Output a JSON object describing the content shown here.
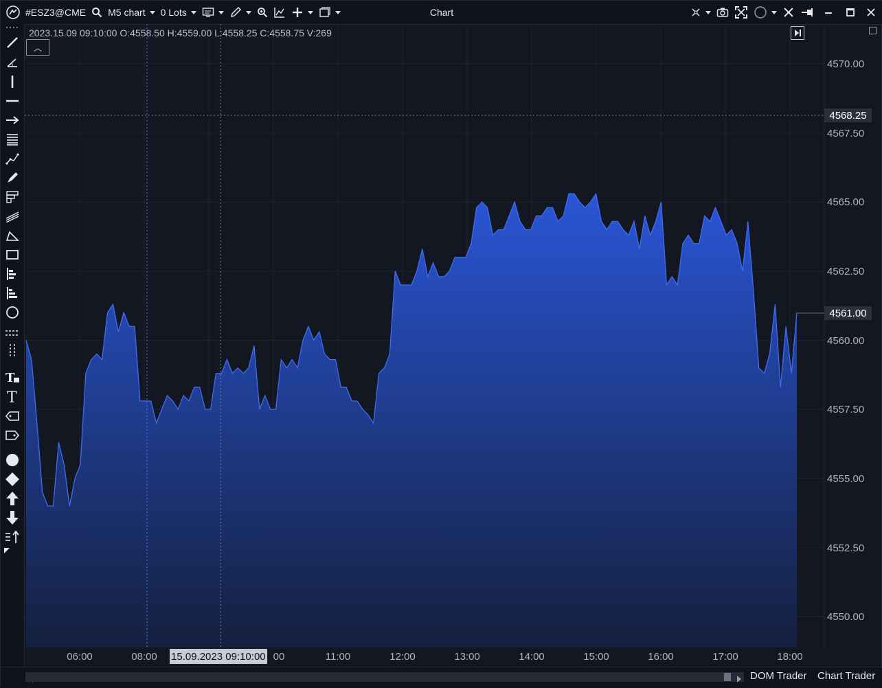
{
  "toolbar": {
    "symbol": "#ESZ3@CME",
    "timeframe": "M5 chart",
    "lots": "0 Lots",
    "title": "Chart"
  },
  "ohlc_info": "2023.15.09 09:10:00 O:4558.50 H:4559.00 L:4558.25 C:4558.75 V:269",
  "crosshair": {
    "price": "4568.25",
    "time_label": "15.09.2023 09:10:00",
    "time_suffix": "00"
  },
  "last_price": "4561.00",
  "price_axis": {
    "labels": [
      "4570.00",
      "4567.50",
      "4565.00",
      "4562.50",
      "4560.00",
      "4557.50",
      "4555.00",
      "4552.50",
      "4550.00"
    ]
  },
  "time_axis": {
    "labels": [
      "06:00",
      "08:00",
      "11:00",
      "12:00",
      "13:00",
      "14:00",
      "15:00",
      "16:00",
      "17:00",
      "18:00"
    ]
  },
  "bottom": {
    "dom_trader": "DOM Trader",
    "chart_trader": "Chart Trader"
  },
  "colors": {
    "background": "#131722",
    "line": "#3f6df0",
    "fill_top": "#2a55d6",
    "fill_bottom": "#14203f"
  },
  "chart_data": {
    "type": "area",
    "ylim": [
      4548.5,
      4571.5
    ],
    "y": [
      4560.0,
      4559.3,
      4557.0,
      4554.5,
      4554.0,
      4554.0,
      4556.3,
      4555.5,
      4554.0,
      4555.0,
      4555.5,
      4558.8,
      4559.3,
      4559.5,
      4559.3,
      4561.0,
      4561.3,
      4560.3,
      4561.0,
      4560.5,
      4560.5,
      4557.8,
      4557.8,
      4557.8,
      4557.0,
      4557.5,
      4558.0,
      4557.8,
      4557.5,
      4558.0,
      4557.8,
      4558.3,
      4558.3,
      4557.5,
      4557.5,
      4558.8,
      4558.8,
      4559.3,
      4558.8,
      4559.0,
      4558.8,
      4559.0,
      4559.8,
      4557.5,
      4558.0,
      4557.5,
      4557.5,
      4559.3,
      4559.0,
      4559.3,
      4559.0,
      4560.0,
      4560.5,
      4560.0,
      4560.3,
      4559.5,
      4559.3,
      4559.3,
      4558.3,
      4558.3,
      4557.8,
      4557.8,
      4557.5,
      4557.3,
      4557.0,
      4558.8,
      4559.0,
      4559.5,
      4562.5,
      4562.0,
      4562.0,
      4562.0,
      4562.5,
      4563.3,
      4562.3,
      4562.8,
      4562.3,
      4562.3,
      4562.5,
      4563.0,
      4563.0,
      4563.0,
      4563.5,
      4564.8,
      4565.0,
      4564.8,
      4563.8,
      4564.0,
      4564.0,
      4564.5,
      4565.0,
      4564.3,
      4564.0,
      4564.0,
      4564.5,
      4564.5,
      4564.8,
      4564.8,
      4564.3,
      4564.5,
      4565.3,
      4565.3,
      4565.0,
      4564.8,
      4565.0,
      4565.3,
      4564.3,
      4564.0,
      4564.3,
      4564.3,
      4564.0,
      4563.8,
      4564.3,
      4563.3,
      4564.5,
      4563.8,
      4564.3,
      4565.0,
      4562.0,
      4562.3,
      4562.0,
      4563.5,
      4563.8,
      4563.5,
      4563.5,
      4564.5,
      4564.3,
      4564.8,
      4564.3,
      4563.8,
      4564.0,
      4563.5,
      4562.5,
      4564.3,
      4561.8,
      4559.0,
      4558.8,
      4559.5,
      4561.3,
      4558.3,
      4560.5,
      4558.8,
      4561.0
    ]
  }
}
